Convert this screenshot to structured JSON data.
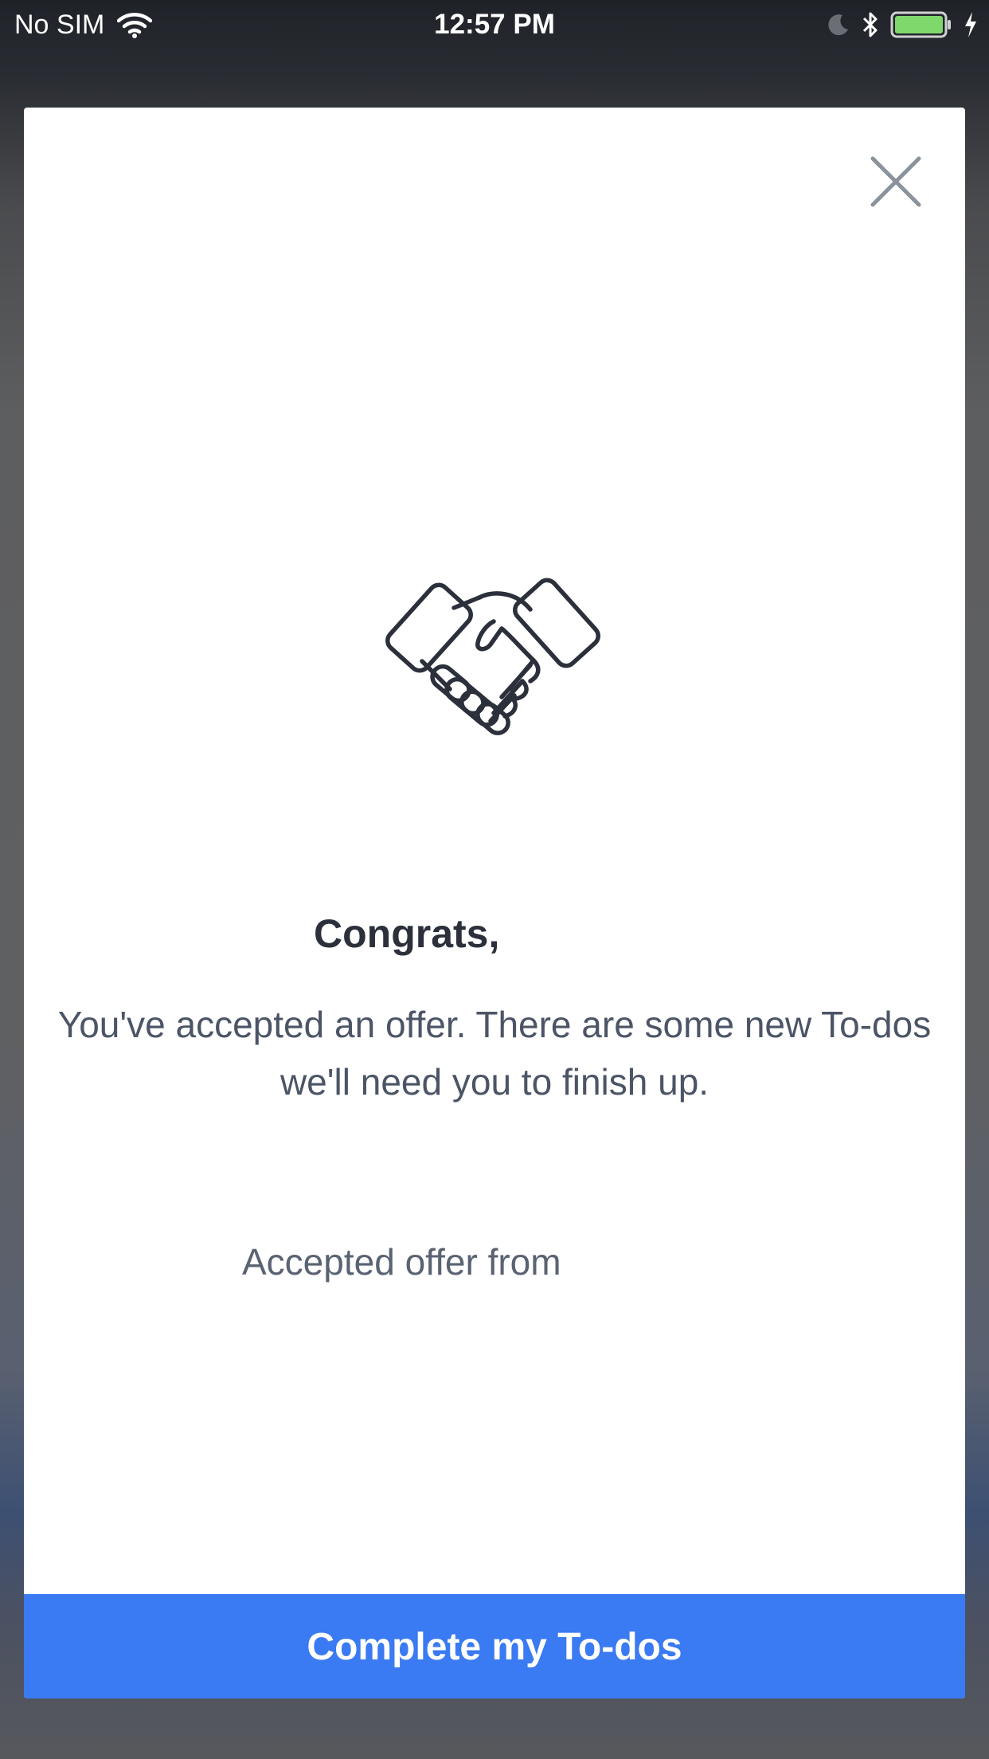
{
  "status_bar": {
    "carrier": "No SIM",
    "time": "12:57 PM",
    "icons": [
      "wifi-icon",
      "moon-icon",
      "bluetooth-icon",
      "battery-icon",
      "charging-bolt-icon"
    ],
    "battery_level": 1.0,
    "battery_color": "#7ed86b"
  },
  "modal": {
    "close_icon": "close-icon",
    "illustration_icon": "handshake-icon",
    "title": "Congrats,",
    "message": "You've accepted an offer. There are some new To-dos we'll need you to finish up.",
    "accepted_offer_label": "Accepted offer from",
    "primary_button_label": "Complete my To-dos"
  },
  "colors": {
    "primary_button": "#3a7af2",
    "title_text": "#2b303b",
    "body_text": "#4c5566",
    "icon_stroke": "#2b303b",
    "close_icon": "#8a939c"
  }
}
